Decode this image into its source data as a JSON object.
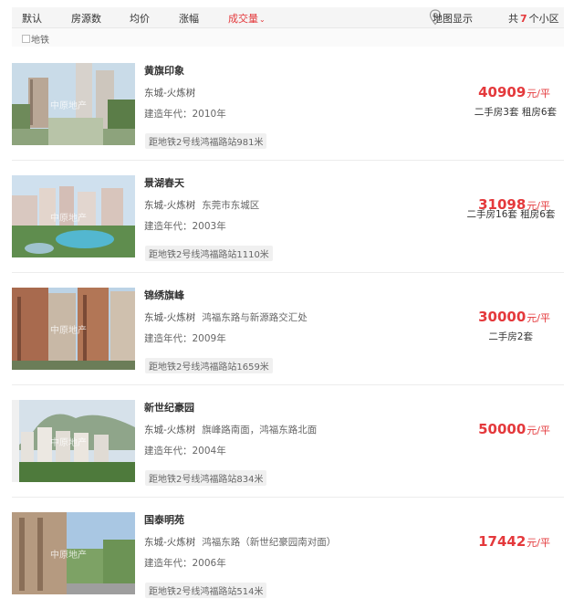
{
  "toolbar": {
    "sort_default": "默认",
    "sort_listings": "房源数",
    "sort_avg": "均价",
    "sort_change": "涨幅",
    "sort_volume": "成交量",
    "map_label": "地图显示",
    "count_prefix": "共",
    "count_num": "7",
    "count_suffix": "个小区",
    "active_color": "#e4393c"
  },
  "filter": {
    "metro_label": "地铁"
  },
  "watermark": "中原地产",
  "items": [
    {
      "name": "黄旗印象",
      "area": "东城-火炼树",
      "address": "",
      "year": "建造年代：2010年",
      "metro": "距地铁2号线鸿福路站981米",
      "price": "40909",
      "unit": "元/平",
      "stock": "二手房3套    租房6套"
    },
    {
      "name": "景湖春天",
      "area": "东城-火炼树",
      "address": "东莞市东城区",
      "year": "建造年代：2003年",
      "metro": "距地铁2号线鸿福路站1110米",
      "price": "31098",
      "unit": "元/平",
      "stock": "二手房16套    租房6套"
    },
    {
      "name": "锦绣旗峰",
      "area": "东城-火炼树",
      "address": "鸿福东路与新源路交汇处",
      "year": "建造年代：2009年",
      "metro": "距地铁2号线鸿福路站1659米",
      "price": "30000",
      "unit": "元/平",
      "stock": "二手房2套"
    },
    {
      "name": "新世纪豪园",
      "area": "东城-火炼树",
      "address": "旗峰路南面，鸿福东路北面",
      "year": "建造年代：2004年",
      "metro": "距地铁2号线鸿福路站834米",
      "price": "50000",
      "unit": "元/平",
      "stock": ""
    },
    {
      "name": "国泰明苑",
      "area": "东城-火炼树",
      "address": "鸿福东路（新世纪豪园南对面）",
      "year": "建造年代：2006年",
      "metro": "距地铁2号线鸿福路站514米",
      "price": "17442",
      "unit": "元/平",
      "stock": ""
    }
  ]
}
